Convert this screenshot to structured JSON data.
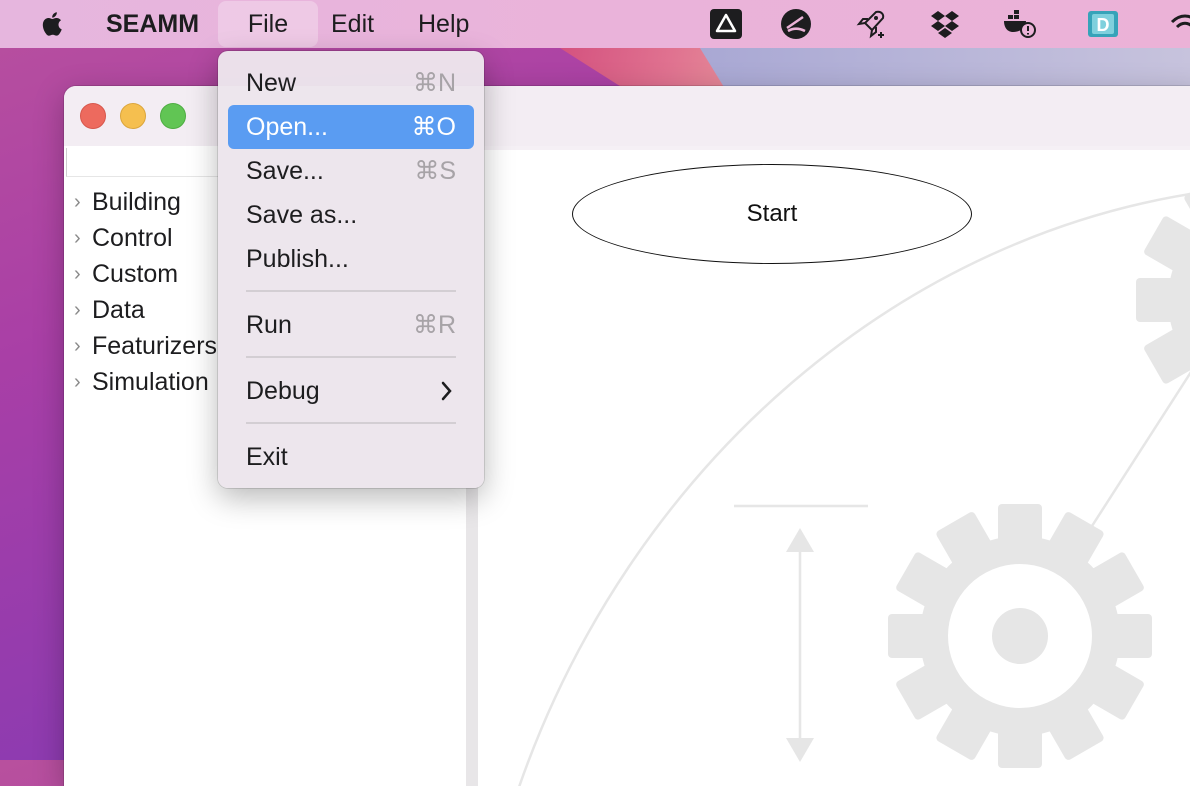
{
  "menubar": {
    "app_name": "SEAMM",
    "menus": [
      "File",
      "Edit",
      "Help"
    ],
    "open_menu": "File",
    "tray_icons": [
      "drive-icon",
      "sketch-icon",
      "rocket-icon",
      "dropbox-icon",
      "docker-icon",
      "dashboard-icon",
      "wifi-icon"
    ]
  },
  "window": {
    "traffic_lights": [
      "close",
      "minimize",
      "maximize"
    ]
  },
  "sidebar": {
    "items": [
      {
        "label": "Building"
      },
      {
        "label": "Control"
      },
      {
        "label": "Custom"
      },
      {
        "label": "Data"
      },
      {
        "label": "Featurizers"
      },
      {
        "label": "Simulation"
      }
    ]
  },
  "file_menu": {
    "items": [
      {
        "label": "New",
        "shortcut": "⌘N"
      },
      {
        "label": "Open...",
        "shortcut": "⌘O",
        "highlighted": true
      },
      {
        "label": "Save...",
        "shortcut": "⌘S"
      },
      {
        "label": "Save as...",
        "shortcut": ""
      },
      {
        "label": "Publish...",
        "shortcut": ""
      },
      {
        "label": "Run",
        "shortcut": "⌘R"
      },
      {
        "label": "Debug",
        "shortcut": "",
        "submenu": true
      },
      {
        "label": "Exit",
        "shortcut": ""
      }
    ]
  },
  "canvas": {
    "start_node": "Start"
  },
  "colors": {
    "highlight": "#5a9cf2",
    "close": "#ed6a5e",
    "minimize": "#f5bf4f",
    "maximize": "#61c554"
  }
}
